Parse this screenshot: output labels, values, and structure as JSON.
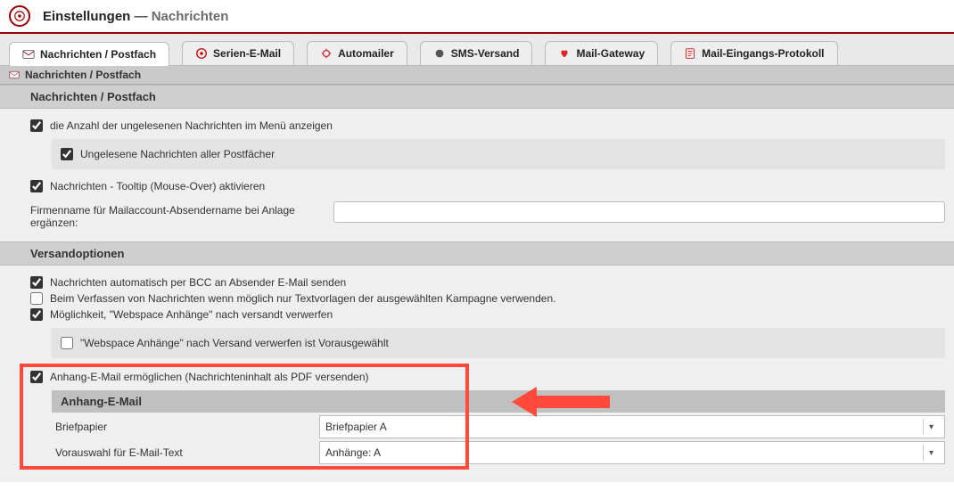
{
  "header": {
    "title_main": "Einstellungen",
    "title_sep": "—",
    "title_sub": "Nachrichten"
  },
  "tabs": [
    {
      "label": "Nachrichten / Postfach",
      "icon": "envelope"
    },
    {
      "label": "Serien-E-Mail",
      "icon": "at-red"
    },
    {
      "label": "Automailer",
      "icon": "gear-red"
    },
    {
      "label": "SMS-Versand",
      "icon": "dot-gray"
    },
    {
      "label": "Mail-Gateway",
      "icon": "heart-red"
    },
    {
      "label": "Mail-Eingangs-Protokoll",
      "icon": "doc-red"
    }
  ],
  "subtab": {
    "label": "Nachrichten / Postfach",
    "icon": "envelope-red"
  },
  "section1": {
    "title": "Nachrichten / Postfach",
    "opt_unread_menu": "die Anzahl der ungelesenen Nachrichten im Menü anzeigen",
    "opt_unread_all": "Ungelesene Nachrichten aller Postfächer",
    "opt_tooltip": "Nachrichten - Tooltip (Mouse-Over) aktivieren",
    "lbl_company": "Firmenname für Mailaccount-Absendername bei Anlage ergänzen:",
    "val_company": ""
  },
  "section2": {
    "title": "Versandoptionen",
    "opt_bcc": "Nachrichten automatisch per BCC an Absender E-Mail senden",
    "opt_campaign": "Beim Verfassen von Nachrichten wenn möglich nur Textvorlagen der ausgewählten Kampagne verwenden.",
    "opt_webspace_discard": "Möglichkeit, \"Webspace Anhänge\" nach versandt verwerfen",
    "opt_webspace_preselect": "\"Webspace Anhänge\" nach Versand verwerfen ist Vorausgewählt",
    "opt_attach_email": "Anhang-E-Mail ermöglichen (Nachrichteninhalt als PDF versenden)",
    "inner_title": "Anhang-E-Mail",
    "lbl_paper": "Briefpapier",
    "val_paper": "Briefpapier A",
    "lbl_pretext": "Vorauswahl für E-Mail-Text",
    "val_pretext": "Anhänge: A"
  }
}
